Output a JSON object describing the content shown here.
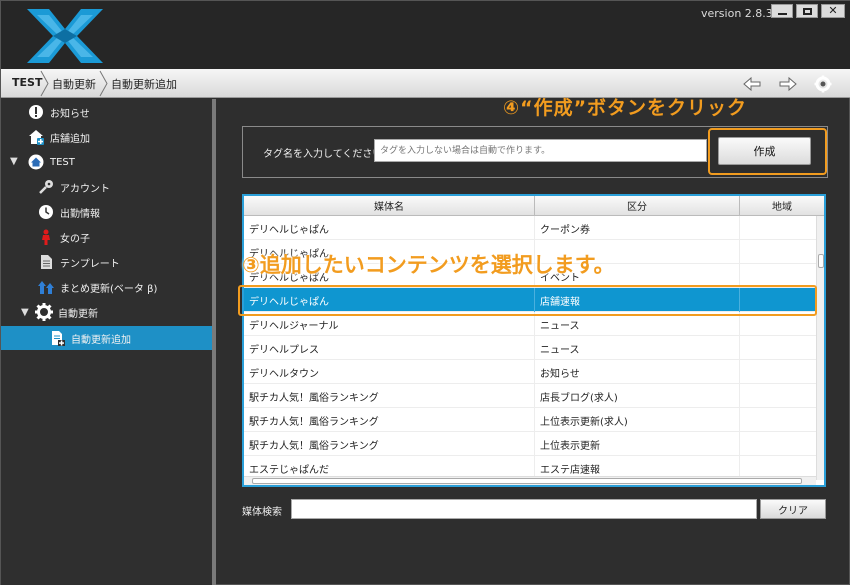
{
  "window": {
    "version": "version 2.8.3"
  },
  "breadcrumb": [
    "TEST",
    "自動更新",
    "自動更新追加"
  ],
  "sidebar": {
    "items": [
      {
        "label": "お知らせ",
        "icon": "info-icon"
      },
      {
        "label": "店舗追加",
        "icon": "add-shop-icon"
      },
      {
        "label": "TEST",
        "icon": "home-icon"
      },
      {
        "label": "アカウント",
        "icon": "key-icon"
      },
      {
        "label": "出勤情報",
        "icon": "clock-icon"
      },
      {
        "label": "女の子",
        "icon": "person-icon"
      },
      {
        "label": "テンプレート",
        "icon": "document-icon"
      },
      {
        "label": "まとめ更新(ベータ β)",
        "icon": "bulk-update-icon"
      },
      {
        "label": "自動更新",
        "icon": "gear-icon"
      },
      {
        "label": "自動更新追加",
        "icon": "document-add-icon"
      }
    ]
  },
  "tag": {
    "label": "タグ名を入力してください。",
    "placeholder": "タグを入力しない場合は自動で作ります。",
    "create_label": "作成"
  },
  "annotations": {
    "step4": "④“作成”ボタンをクリック",
    "step3": "③追加したいコンテンツを選択します。"
  },
  "table": {
    "headers": [
      "媒体名",
      "区分",
      "地域"
    ],
    "rows": [
      {
        "media": "デリヘルじゃぱん",
        "category": "クーポン券",
        "region": ""
      },
      {
        "media": "デリヘルじゃぱん",
        "category": "",
        "region": ""
      },
      {
        "media": "デリヘルじゃぱん",
        "category": "イベント",
        "region": ""
      },
      {
        "media": "デリヘルじゃぱん",
        "category": "店舗速報",
        "region": ""
      },
      {
        "media": "デリヘルジャーナル",
        "category": "ニュース",
        "region": ""
      },
      {
        "media": "デリヘルプレス",
        "category": "ニュース",
        "region": ""
      },
      {
        "media": "デリヘルタウン",
        "category": "お知らせ",
        "region": ""
      },
      {
        "media": "駅チカ人気！風俗ランキング",
        "category": "店長ブログ(求人)",
        "region": ""
      },
      {
        "media": "駅チカ人気！風俗ランキング",
        "category": "上位表示更新(求人)",
        "region": ""
      },
      {
        "media": "駅チカ人気！風俗ランキング",
        "category": "上位表示更新",
        "region": ""
      },
      {
        "media": "エステじゃぱんだ",
        "category": "エステ店速報",
        "region": ""
      }
    ]
  },
  "search": {
    "label": "媒体検索",
    "value": "",
    "clear_label": "クリア"
  },
  "colors": {
    "accent": "#1e90c6",
    "highlight": "#f29c1f",
    "selection": "#0f96d0"
  }
}
